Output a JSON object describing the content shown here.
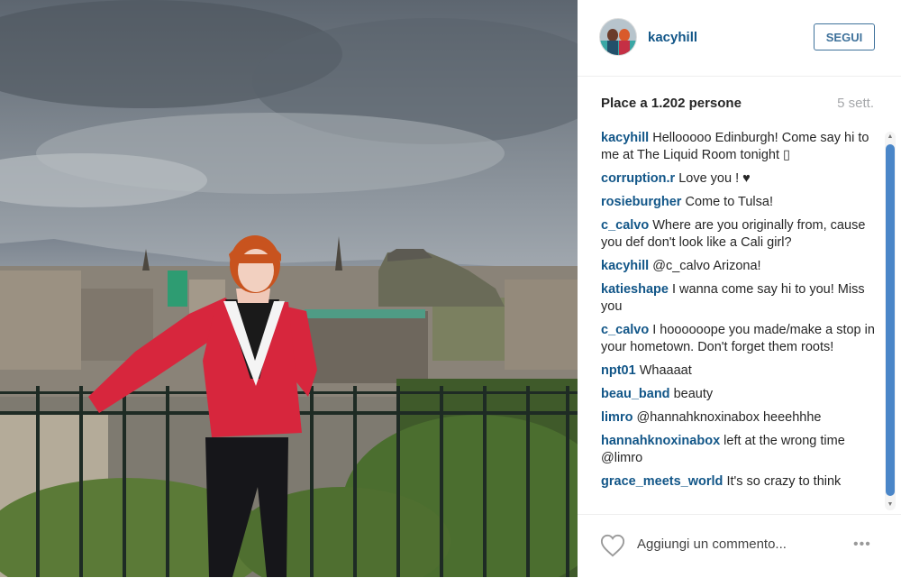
{
  "post": {
    "username": "kacyhill",
    "follow_label": "SEGUI",
    "likes_text": "Place a 1.202 persone",
    "time_ago": "5 sett."
  },
  "comments": [
    {
      "user": "kacyhill",
      "text": "Hellooooo Edinburgh! Come say hi to me at The Liquid Room tonight ▯"
    },
    {
      "user": "corruption.r",
      "text": "Love you ! ♥"
    },
    {
      "user": "rosieburgher",
      "text": "Come to Tulsa!"
    },
    {
      "user": "c_calvo",
      "text": "Where are you originally from, cause you def don't look like a Cali girl?"
    },
    {
      "user": "kacyhill",
      "text": "@c_calvo Arizona!"
    },
    {
      "user": "katieshape",
      "text": "I wanna come say hi to you! Miss you"
    },
    {
      "user": "c_calvo",
      "text": "I hoooooope you made/make a stop in your hometown. Don't forget them roots!"
    },
    {
      "user": "npt01",
      "text": "Whaaaat"
    },
    {
      "user": "beau_band",
      "text": "beauty"
    },
    {
      "user": "limro",
      "text": "@hannahknoxinabox heeehhhe"
    },
    {
      "user": "hannahknoxinabox",
      "text": "left at the wrong time @limro"
    },
    {
      "user": "grace_meets_world",
      "text": "It's so crazy to think"
    }
  ],
  "footer": {
    "add_comment_placeholder": "Aggiungi un commento...",
    "more_label": "•••"
  },
  "icons": {
    "like": "heart-icon",
    "more": "more-options-icon",
    "scroll_up": "scroll-up-arrow-icon",
    "scroll_down": "scroll-down-arrow-icon"
  },
  "colors": {
    "username_link": "#125688",
    "follow_border": "#3f729b",
    "muted_text": "#a5a7aa",
    "scroll_thumb": "#4a86c8"
  }
}
